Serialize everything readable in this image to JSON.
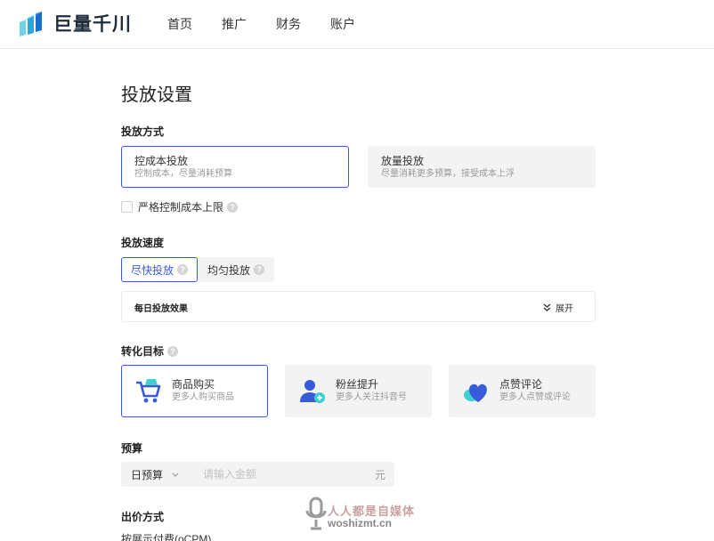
{
  "header": {
    "logo_text": "巨量千川",
    "nav": [
      "首页",
      "推广",
      "财务",
      "账户"
    ]
  },
  "page_title": "投放设置",
  "delivery_method": {
    "title": "投放方式",
    "options": [
      {
        "title": "控成本投放",
        "desc": "控制成本，尽量消耗预算",
        "selected": true
      },
      {
        "title": "放量投放",
        "desc": "尽量消耗更多预算，接受成本上浮",
        "selected": false
      }
    ],
    "checkbox_label": "严格控制成本上限"
  },
  "delivery_speed": {
    "title": "投放速度",
    "tabs": [
      {
        "label": "尽快投放",
        "selected": true
      },
      {
        "label": "均匀投放",
        "selected": false
      }
    ],
    "daily_effect_label": "每日投放效果",
    "expand_label": "展开"
  },
  "conversion_goal": {
    "title": "转化目标",
    "options": [
      {
        "title": "商品购买",
        "desc": "更多人购买商品",
        "icon": "shopping-cart-icon",
        "selected": true
      },
      {
        "title": "粉丝提升",
        "desc": "更多人关注抖音号",
        "icon": "add-follower-icon",
        "selected": false
      },
      {
        "title": "点赞评论",
        "desc": "更多人点赞或评论",
        "icon": "heart-comment-icon",
        "selected": false
      }
    ]
  },
  "budget": {
    "title": "预算",
    "type": "日预算",
    "placeholder": "请输入金额",
    "unit": "元"
  },
  "bid": {
    "title": "出价方式",
    "value": "按展示付费(oCPM)"
  },
  "watermark": {
    "text1": "人人都是自媒体",
    "text2": "woshizmt.cn"
  },
  "colors": {
    "accent": "#3a5bd9",
    "card_bg": "#f3f3f3"
  }
}
